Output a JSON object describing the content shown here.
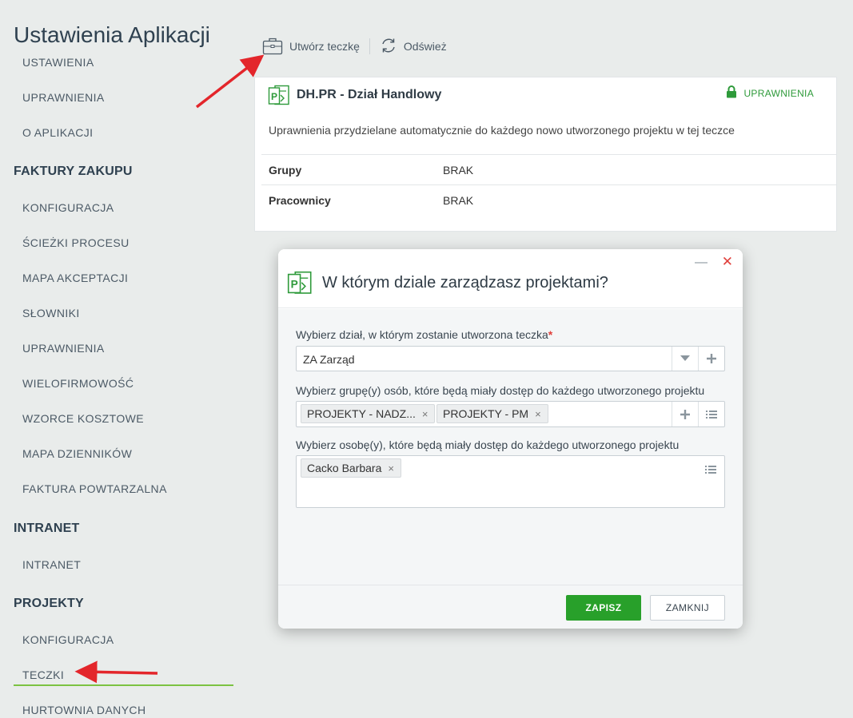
{
  "app_title": "Ustawienia Aplikacji",
  "sidebar": {
    "items": [
      {
        "label": "USTAWIENIA",
        "type": "item"
      },
      {
        "label": "UPRAWNIENIA",
        "type": "item"
      },
      {
        "label": "O APLIKACJI",
        "type": "item"
      },
      {
        "label": "FAKTURY ZAKUPU",
        "type": "section"
      },
      {
        "label": "KONFIGURACJA",
        "type": "item"
      },
      {
        "label": "ŚCIEŻKI PROCESU",
        "type": "item"
      },
      {
        "label": "MAPA AKCEPTACJI",
        "type": "item"
      },
      {
        "label": "SŁOWNIKI",
        "type": "item"
      },
      {
        "label": "UPRAWNIENIA",
        "type": "item"
      },
      {
        "label": "WIELOFIRMOWOŚĆ",
        "type": "item"
      },
      {
        "label": "WZORCE KOSZTOWE",
        "type": "item"
      },
      {
        "label": "MAPA DZIENNIKÓW",
        "type": "item"
      },
      {
        "label": "FAKTURA POWTARZALNA",
        "type": "item"
      },
      {
        "label": "INTRANET",
        "type": "section"
      },
      {
        "label": "INTRANET",
        "type": "item"
      },
      {
        "label": "PROJEKTY",
        "type": "section"
      },
      {
        "label": "KONFIGURACJA",
        "type": "item"
      },
      {
        "label": "TECZKI",
        "type": "item",
        "active": true
      },
      {
        "label": "HURTOWNIA DANYCH",
        "type": "item"
      }
    ]
  },
  "toolbar": {
    "create_label": "Utwórz teczkę",
    "refresh_label": "Odśwież"
  },
  "card": {
    "title": "DH.PR - Dział Handlowy",
    "permissions_link": "UPRAWNIENIA",
    "description": "Uprawnienia przydzielane automatycznie do każdego nowo utworzonego projektu w tej teczce",
    "rows": [
      {
        "key": "Grupy",
        "value": "BRAK"
      },
      {
        "key": "Pracownicy",
        "value": "BRAK"
      }
    ]
  },
  "modal": {
    "title": "W którym dziale zarządzasz projektami?",
    "department_label": "Wybierz dział, w którym zostanie utworzona teczka",
    "required_mark": "*",
    "department_value": "ZA Zarząd",
    "groups_label": "Wybierz grupę(y) osób, które będą miały dostęp do każdego utworzonego projektu",
    "groups_tags": [
      "PROJEKTY - NADZ...",
      "PROJEKTY - PM"
    ],
    "persons_label": "Wybierz osobę(y), które będą miały dostęp do każdego utworzonego projektu",
    "persons_tags": [
      "Cacko Barbara"
    ],
    "save_label": "ZAPISZ",
    "close_label": "ZAMKNIJ",
    "tag_remove": "×"
  },
  "colors": {
    "accent_green": "#28a02a",
    "active_underline": "#7cc242",
    "close_red": "#e0403c",
    "annotation_arrow": "#e3262b"
  },
  "icons": [
    "briefcase-icon",
    "refresh-icon",
    "project-folder-icon",
    "lock-icon",
    "close-icon",
    "minimize-icon",
    "chevron-down-icon",
    "plus-icon",
    "list-icon"
  ]
}
